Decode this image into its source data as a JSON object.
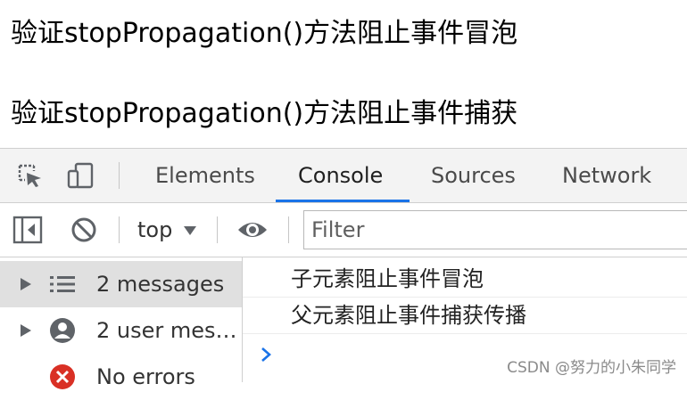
{
  "page": {
    "line1": "验证stopPropagation()方法阻止事件冒泡",
    "line2": "验证stopPropagation()方法阻止事件捕获"
  },
  "devtools": {
    "tabs": [
      {
        "label": "Elements",
        "active": false
      },
      {
        "label": "Console",
        "active": true
      },
      {
        "label": "Sources",
        "active": false
      },
      {
        "label": "Network",
        "active": false
      }
    ],
    "toolbar_icons": [
      "inspect-element-icon",
      "device-toggle-icon"
    ],
    "console_toolbar": {
      "context": "top",
      "filter_placeholder": "Filter",
      "icons": [
        "sidebar-toggle-icon",
        "clear-console-icon",
        "eye-icon"
      ]
    },
    "sidebar": [
      {
        "label": "2 messages",
        "icon": "list-icon",
        "selected": true
      },
      {
        "label": "2 user mes…",
        "icon": "user-icon",
        "selected": false
      },
      {
        "label": "No errors",
        "icon": "error-icon",
        "selected": false
      }
    ],
    "logs": [
      "子元素阻止事件冒泡",
      "父元素阻止事件捕获传播"
    ]
  },
  "watermark": "CSDN @努力的小朱同学",
  "colors": {
    "accent": "#1a73e8",
    "error": "#d93025",
    "toolbar_bg": "#f3f3f3",
    "selected_bg": "#e0e0e0"
  }
}
